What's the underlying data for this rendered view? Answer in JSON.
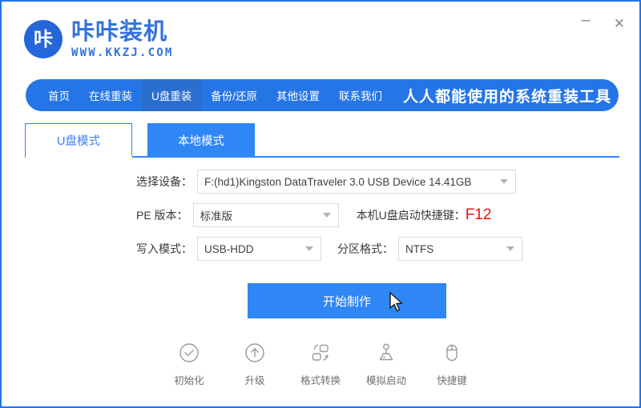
{
  "window": {
    "minimize_label": "–",
    "close_label": "✕"
  },
  "brand": {
    "logo_glyph": "咔",
    "name": "咔咔装机",
    "url": "WWW.KKZJ.COM"
  },
  "nav": {
    "items": [
      {
        "label": "首页",
        "active": false
      },
      {
        "label": "在线重装",
        "active": false
      },
      {
        "label": "U盘重装",
        "active": true
      },
      {
        "label": "备份/还原",
        "active": false
      },
      {
        "label": "其他设置",
        "active": false
      },
      {
        "label": "联系我们",
        "active": false
      }
    ],
    "slogan": "人人都能使用的系统重装工具"
  },
  "tabs": [
    {
      "label": "U盘模式",
      "active": true
    },
    {
      "label": "本地模式",
      "active": false
    }
  ],
  "form": {
    "device_label": "选择设备：",
    "device_value": "F:(hd1)Kingston DataTraveler 3.0 USB Device 14.41GB",
    "pe_label": "PE 版本：",
    "pe_value": "标准版",
    "hotkey_label": "本机U盘启动快捷键：",
    "hotkey_value": "F12",
    "write_label": "写入模式：",
    "write_value": "USB-HDD",
    "partition_label": "分区格式：",
    "partition_value": "NTFS"
  },
  "primary_button": {
    "label": "开始制作"
  },
  "tools": [
    {
      "icon": "check-circle-icon",
      "label": "初始化"
    },
    {
      "icon": "upgrade-arrow-icon",
      "label": "升级"
    },
    {
      "icon": "format-convert-icon",
      "label": "格式转换"
    },
    {
      "icon": "joystick-icon",
      "label": "模拟启动"
    },
    {
      "icon": "mouse-icon",
      "label": "快捷键"
    }
  ],
  "colors": {
    "brand_blue": "#3372dc",
    "nav_blue": "#2575e6",
    "nav_active_blue": "#2a6ed0",
    "tab_blue": "#2f86f5",
    "accent_red": "#e8120f",
    "border_gray": "#d9d9d9"
  }
}
